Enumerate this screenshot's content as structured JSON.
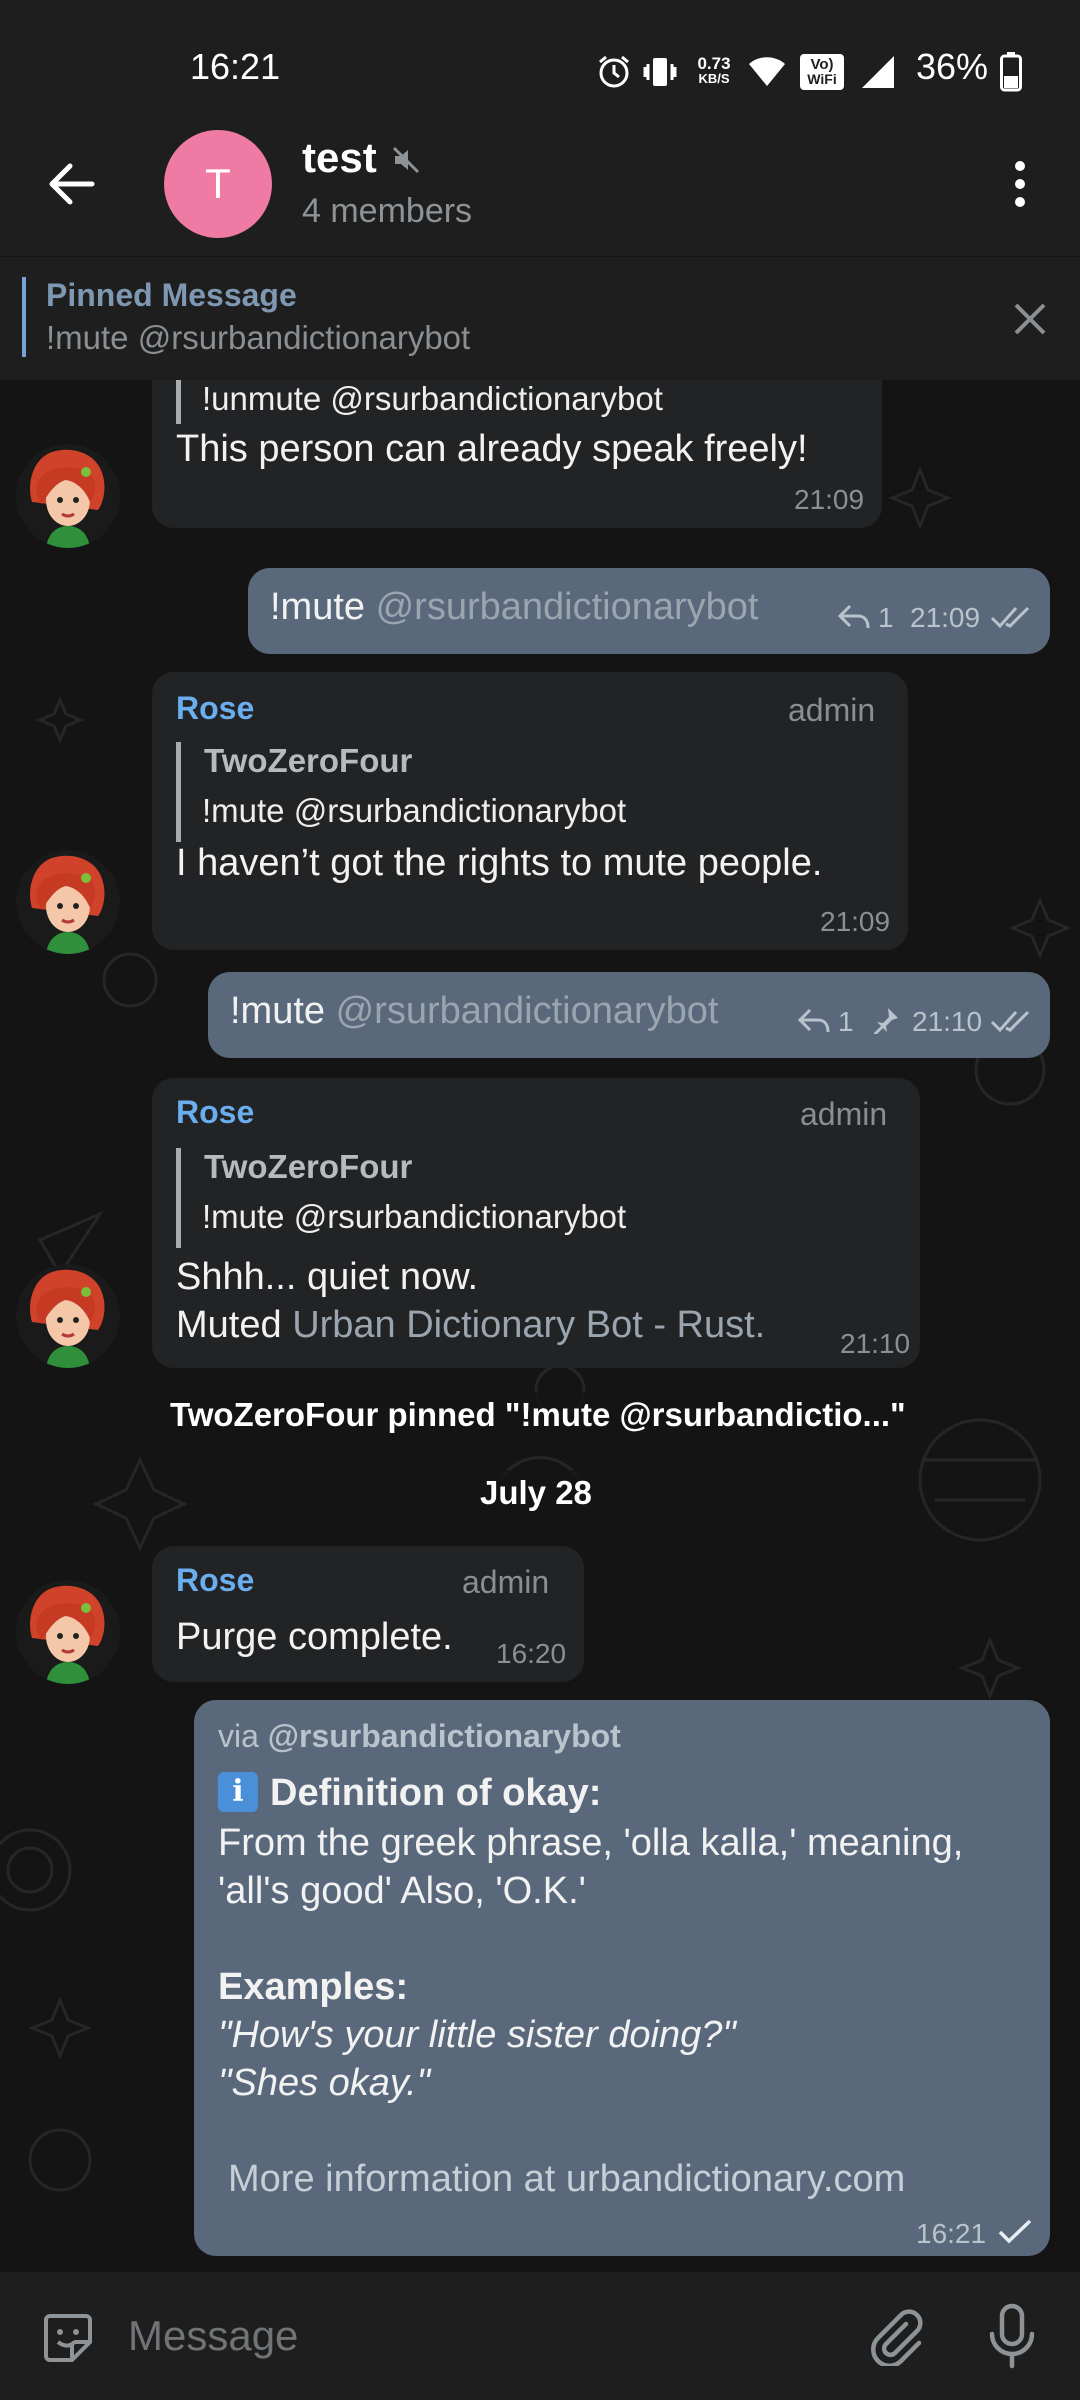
{
  "status_bar": {
    "time": "16:21",
    "net_speed_top": "0.73",
    "net_speed_bottom": "KB/S",
    "volte": "Vo)",
    "wifi_label": "WiFi",
    "battery": "36%",
    "icons": [
      "alarm-icon",
      "vibrate-icon",
      "wifi-icon",
      "volte-icon",
      "signal-icon",
      "battery-icon"
    ]
  },
  "header": {
    "avatar_letter": "T",
    "avatar_color": "#ef7aa3",
    "title": "test",
    "subtitle": "4 members",
    "icons": [
      "back-arrow-icon",
      "muted-speaker-icon",
      "more-vertical-icon"
    ]
  },
  "pinned": {
    "title": "Pinned Message",
    "text": "!mute @rsurbandictionarybot"
  },
  "messages": {
    "m1": {
      "quote_text": "!unmute @rsurbandictionarybot",
      "text": "This person can already speak freely!",
      "time": "21:09"
    },
    "m2": {
      "cmd": "!mute",
      "mention": "@rsurbandictionarybot",
      "replies": "1",
      "time": "21:09"
    },
    "m3": {
      "sender": "Rose",
      "role": "admin",
      "quote_name": "TwoZeroFour",
      "quote_text": "!mute @rsurbandictionarybot",
      "text": "I haven’t got the rights to mute people.",
      "time": "21:09"
    },
    "m4": {
      "cmd": "!mute",
      "mention": "@rsurbandictionarybot",
      "replies": "1",
      "time": "21:10"
    },
    "m5": {
      "sender": "Rose",
      "role": "admin",
      "quote_name": "TwoZeroFour",
      "quote_text": "!mute @rsurbandictionarybot",
      "line1": "Shhh... quiet now.",
      "line2_prefix": "Muted",
      "line2_link": "Urban Dictionary Bot - Rust.",
      "time": "21:10"
    },
    "service_pinned": "TwoZeroFour pinned \"!mute @rsurbandictio...\"",
    "date_separator": "July 28",
    "m6": {
      "sender": "Rose",
      "role": "admin",
      "text": "Purge complete.",
      "time": "16:20"
    },
    "m7": {
      "via_prefix": "via",
      "via_bot": "@rsurbandictionarybot",
      "info_emoji": "i",
      "definition_title": "Definition of okay:",
      "definition_line1": "From the greek phrase, 'olla kalla,' meaning,",
      "definition_line2": "'all's good' Also, 'O.K.'",
      "examples_title": "Examples:",
      "example1": "\"How's your little sister doing?\"",
      "example2": "\"Shes okay.\"",
      "more_info": "More information at urbandictionary.com",
      "time": "16:21"
    }
  },
  "input": {
    "placeholder": "Message",
    "icons": [
      "sticker-emoji-icon",
      "attach-paperclip-icon",
      "microphone-icon"
    ]
  }
}
